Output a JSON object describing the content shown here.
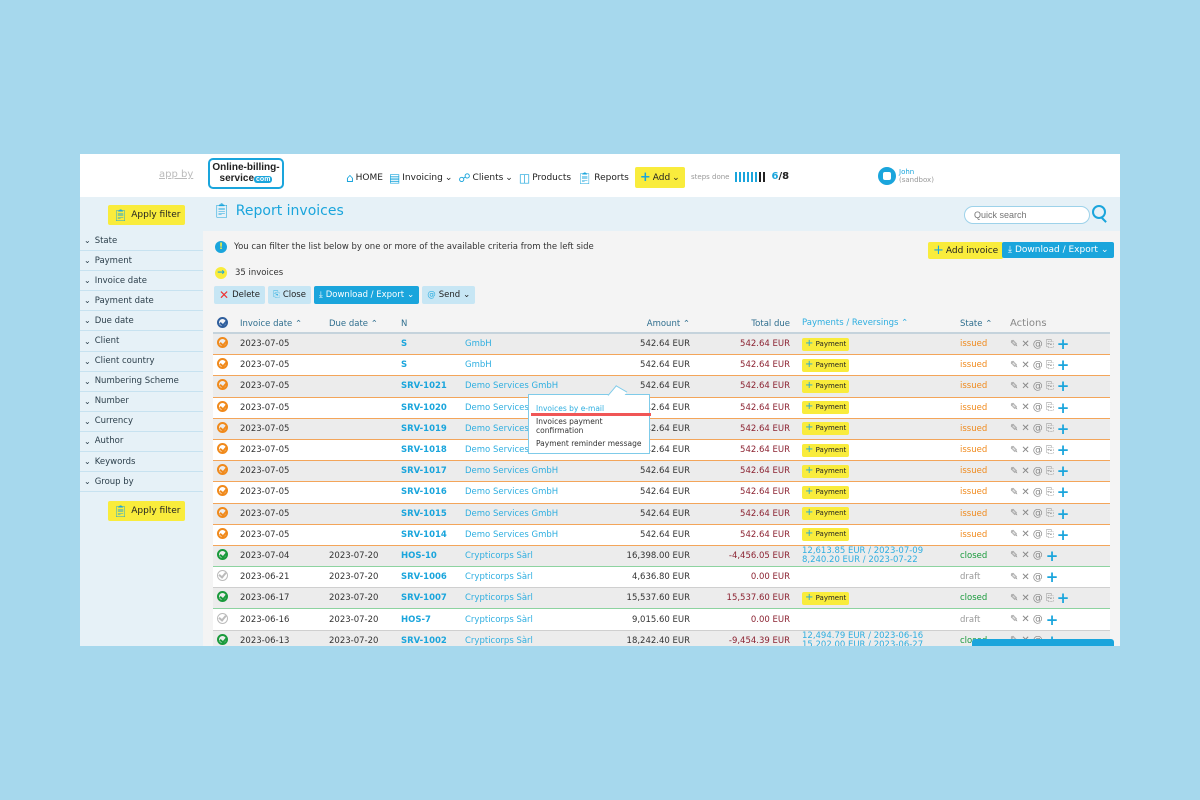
{
  "header": {
    "app_by": "app by",
    "logo_line1": "Online-billing-",
    "logo_line2": "service",
    "logo_com": "com",
    "nav": [
      {
        "label": "HOME",
        "icon": "home-icon",
        "dropdown": false
      },
      {
        "label": "Invoicing",
        "icon": "invoicing-icon",
        "dropdown": true
      },
      {
        "label": "Clients",
        "icon": "clients-icon",
        "dropdown": true
      },
      {
        "label": "Products",
        "icon": "products-icon",
        "dropdown": false
      },
      {
        "label": "Reports",
        "icon": "reports-icon",
        "dropdown": false
      }
    ],
    "add_label": "Add",
    "steps_label": "steps done",
    "steps_done": 6,
    "steps_total": 8,
    "steps_text_done": "6",
    "steps_text_total": "/8",
    "user_name": "John",
    "user_sub": "(sandbox)"
  },
  "subheader": {
    "apply_filter": "Apply filter",
    "page_title": "Report invoices",
    "quick_search": "Quick search"
  },
  "sidebar": {
    "filters": [
      "State",
      "Payment",
      "Invoice date",
      "Payment date",
      "Due date",
      "Client",
      "Client country",
      "Numbering Scheme",
      "Number",
      "Currency",
      "Author",
      "Keywords",
      "Group by"
    ],
    "apply_filter": "Apply filter"
  },
  "main": {
    "info_text": "You can filter the list below by one or more of the available criteria from the left side",
    "count_text": "35 invoices",
    "add_invoice": "Add invoice",
    "download_export": "Download / Export",
    "toolbar": {
      "delete": "Delete",
      "close": "Close",
      "download_export": "Download / Export",
      "send": "Send"
    },
    "send_menu": [
      "Invoices by e-mail",
      "Invoices payment confirmation",
      "Payment reminder message"
    ],
    "columns": {
      "invoice_date": "Invoice date",
      "due_date": "Due date",
      "number": "N",
      "client": "",
      "amount": "Amount",
      "total_due": "Total due",
      "payments": "Payments / Reversings",
      "state": "State",
      "actions": "Actions"
    },
    "payment_button": "Payment",
    "rows": [
      {
        "check": "orange",
        "invoice_date": "2023-07-05",
        "due_date": "",
        "number": "S",
        "client": "GmbH",
        "amount": "542.64 EUR",
        "total_due": "542.64 EUR",
        "payments": [],
        "pay_button": true,
        "state": "issued",
        "edit_extra": true
      },
      {
        "check": "orange",
        "invoice_date": "2023-07-05",
        "due_date": "",
        "number": "S",
        "client": "GmbH",
        "amount": "542.64 EUR",
        "total_due": "542.64 EUR",
        "payments": [],
        "pay_button": true,
        "state": "issued",
        "edit_extra": true
      },
      {
        "check": "orange",
        "invoice_date": "2023-07-05",
        "due_date": "",
        "number": "SRV-1021",
        "client": "Demo Services GmbH",
        "amount": "542.64 EUR",
        "total_due": "542.64 EUR",
        "payments": [],
        "pay_button": true,
        "state": "issued",
        "edit_extra": true
      },
      {
        "check": "orange",
        "invoice_date": "2023-07-05",
        "due_date": "",
        "number": "SRV-1020",
        "client": "Demo Services GmbH",
        "amount": "542.64 EUR",
        "total_due": "542.64 EUR",
        "payments": [],
        "pay_button": true,
        "state": "issued",
        "edit_extra": true
      },
      {
        "check": "orange",
        "invoice_date": "2023-07-05",
        "due_date": "",
        "number": "SRV-1019",
        "client": "Demo Services GmbH",
        "amount": "542.64 EUR",
        "total_due": "542.64 EUR",
        "payments": [],
        "pay_button": true,
        "state": "issued",
        "edit_extra": true
      },
      {
        "check": "orange",
        "invoice_date": "2023-07-05",
        "due_date": "",
        "number": "SRV-1018",
        "client": "Demo Services GmbH",
        "amount": "542.64 EUR",
        "total_due": "542.64 EUR",
        "payments": [],
        "pay_button": true,
        "state": "issued",
        "edit_extra": true
      },
      {
        "check": "orange",
        "invoice_date": "2023-07-05",
        "due_date": "",
        "number": "SRV-1017",
        "client": "Demo Services GmbH",
        "amount": "542.64 EUR",
        "total_due": "542.64 EUR",
        "payments": [],
        "pay_button": true,
        "state": "issued",
        "edit_extra": true
      },
      {
        "check": "orange",
        "invoice_date": "2023-07-05",
        "due_date": "",
        "number": "SRV-1016",
        "client": "Demo Services GmbH",
        "amount": "542.64 EUR",
        "total_due": "542.64 EUR",
        "payments": [],
        "pay_button": true,
        "state": "issued",
        "edit_extra": true
      },
      {
        "check": "orange",
        "invoice_date": "2023-07-05",
        "due_date": "",
        "number": "SRV-1015",
        "client": "Demo Services GmbH",
        "amount": "542.64 EUR",
        "total_due": "542.64 EUR",
        "payments": [],
        "pay_button": true,
        "state": "issued",
        "edit_extra": true
      },
      {
        "check": "orange",
        "invoice_date": "2023-07-05",
        "due_date": "",
        "number": "SRV-1014",
        "client": "Demo Services GmbH",
        "amount": "542.64 EUR",
        "total_due": "542.64 EUR",
        "payments": [],
        "pay_button": true,
        "state": "issued",
        "edit_extra": true
      },
      {
        "check": "green",
        "invoice_date": "2023-07-04",
        "due_date": "2023-07-20",
        "number": "HOS-10",
        "client": "Crypticorps Sàrl",
        "amount": "16,398.00 EUR",
        "total_due": "-4,456.05 EUR",
        "payments": [
          "12,613.85 EUR / 2023-07-09",
          "8,240.20 EUR / 2023-07-22"
        ],
        "pay_button": false,
        "state": "closed",
        "edit_extra": false
      },
      {
        "check": "grey",
        "invoice_date": "2023-06-21",
        "due_date": "2023-07-20",
        "number": "SRV-1006",
        "client": "Crypticorps Sàrl",
        "amount": "4,636.80 EUR",
        "total_due": "0.00 EUR",
        "payments": [],
        "pay_button": false,
        "state": "draft",
        "edit_extra": false
      },
      {
        "check": "green",
        "invoice_date": "2023-06-17",
        "due_date": "2023-07-20",
        "number": "SRV-1007",
        "client": "Crypticorps Sàrl",
        "amount": "15,537.60 EUR",
        "total_due": "15,537.60 EUR",
        "payments": [],
        "pay_button": true,
        "state": "closed",
        "edit_extra": true
      },
      {
        "check": "grey",
        "invoice_date": "2023-06-16",
        "due_date": "2023-07-20",
        "number": "HOS-7",
        "client": "Crypticorps Sàrl",
        "amount": "9,015.60 EUR",
        "total_due": "0.00 EUR",
        "payments": [],
        "pay_button": false,
        "state": "draft",
        "edit_extra": false
      },
      {
        "check": "green",
        "invoice_date": "2023-06-13",
        "due_date": "2023-07-20",
        "number": "SRV-1002",
        "client": "Crypticorps Sàrl",
        "amount": "18,242.40 EUR",
        "total_due": "-9,454.39 EUR",
        "payments": [
          "12,494.79 EUR / 2023-06-16",
          "15,202.00 EUR / 2023-06-27"
        ],
        "pay_button": false,
        "state": "closed",
        "edit_extra": false
      }
    ]
  },
  "colors": {
    "accent": "#1aa5dc",
    "highlight": "#f9ec3c",
    "issued": "#f08a1c",
    "closed": "#1a9a3c",
    "draft": "#999999",
    "due": "#8b2231",
    "background": "#a6d8ed"
  }
}
